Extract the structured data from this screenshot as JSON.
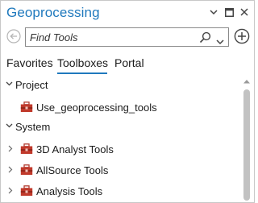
{
  "window": {
    "title": "Geoprocessing"
  },
  "search": {
    "placeholder": "Find Tools"
  },
  "tabs": [
    {
      "label": "Favorites"
    },
    {
      "label": "Toolboxes"
    },
    {
      "label": "Portal"
    }
  ],
  "active_tab": "Toolboxes",
  "tree": {
    "project": {
      "label": "Project",
      "children": [
        {
          "label": "Use_geoprocessing_tools"
        }
      ]
    },
    "system": {
      "label": "System",
      "children": [
        {
          "label": "3D Analyst Tools"
        },
        {
          "label": "AllSource Tools"
        },
        {
          "label": "Analysis Tools"
        }
      ]
    }
  },
  "colors": {
    "accent": "#1f79bd",
    "toolbox_red": "#c0392b",
    "icon_gray": "#5a5a5a"
  },
  "icons": {
    "dropdown": "chevron-down-icon",
    "close": "close-icon",
    "maximize": "maximize-icon",
    "back": "back-arrow-icon",
    "search": "search-icon",
    "add": "add-circle-icon",
    "expanded": "chevron-down-icon",
    "collapsed": "chevron-right-icon",
    "toolbox": "toolbox-icon"
  }
}
